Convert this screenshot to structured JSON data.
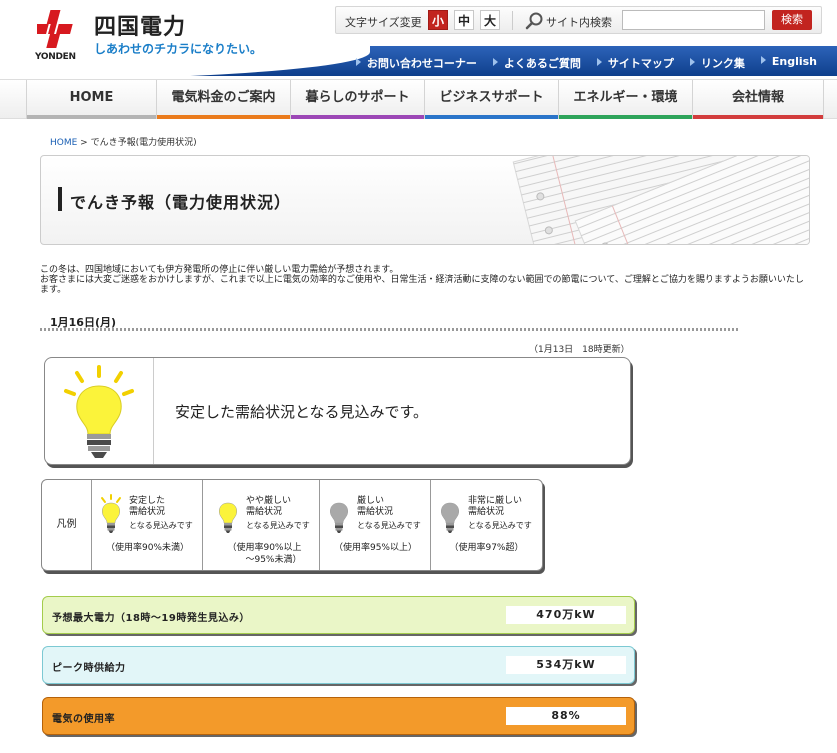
{
  "header": {
    "brand_name": "四国電力",
    "brand_en": "YONDEN",
    "tagline": "しあわせのチカラになりたい。",
    "font_size_label": "文字サイズ変更",
    "font_sizes": {
      "small": "小",
      "medium": "中",
      "large": "大"
    },
    "search_label": "サイト内検索",
    "search_value": "",
    "search_button": "検索",
    "links": [
      "お問い合わせコーナー",
      "よくあるご質問",
      "サイトマップ",
      "リンク集",
      "English"
    ]
  },
  "nav": [
    {
      "label": "HOME",
      "color": "#b4b4b4"
    },
    {
      "label": "電気料金のご案内",
      "color": "#ea7b1c"
    },
    {
      "label": "暮らしのサポート",
      "color": "#9c47b6"
    },
    {
      "label": "ビジネスサポート",
      "color": "#2a74c9"
    },
    {
      "label": "エネルギー・環境",
      "color": "#2ea45a"
    },
    {
      "label": "会社情報",
      "color": "#d23c3c"
    }
  ],
  "breadcrumb": {
    "home": "HOME",
    "separator": " > ",
    "current": "でんき予報(電力使用状況)"
  },
  "title": "でんき予報（電力使用状況）",
  "intro": {
    "line1": "この冬は、四国地域においても伊方発電所の停止に伴い厳しい電力需給が予想されます。",
    "line2": "お客さまには大変ご迷惑をおかけしますが、これまで以上に電気の効率的なご使用や、日常生活・経済活動に支障のない範囲での節電について、ご理解とご協力を賜りますようお願いいたします。"
  },
  "date": "1月16日(月)",
  "updated": "（1月13日　18時更新）",
  "forecast": {
    "message": "安定した需給状況となる見込みです。",
    "bulb_color": "#fbf33a"
  },
  "legend": {
    "label": "凡例",
    "items": [
      {
        "title": "安定した\n需給状況",
        "sub": "となる見込みです",
        "usage": "（使用率90%未満）",
        "bulb": "#fbf33a",
        "rays": true
      },
      {
        "title": "やや厳しい\n需給状況",
        "sub": "となる見込みです",
        "usage": "（使用率90%以上\n　　～95%未満）",
        "bulb": "#fbf33a",
        "rays": false
      },
      {
        "title": "厳しい\n需給状況",
        "sub": "となる見込みです",
        "usage": "（使用率95%以上）",
        "bulb": "#a9a9a9",
        "rays": false
      },
      {
        "title": "非常に厳しい\n需給状況",
        "sub": "となる見込みです",
        "usage": "（使用率97%超）",
        "bulb": "#a9a9a9",
        "rays": false
      }
    ]
  },
  "stats": {
    "demand": {
      "label": "予想最大電力（18時～19時発生見込み）",
      "value": "470万kW"
    },
    "supply": {
      "label": "ピーク時供給力",
      "value": "534万kW"
    },
    "usage": {
      "label": "電気の使用率",
      "value": "88%"
    }
  }
}
